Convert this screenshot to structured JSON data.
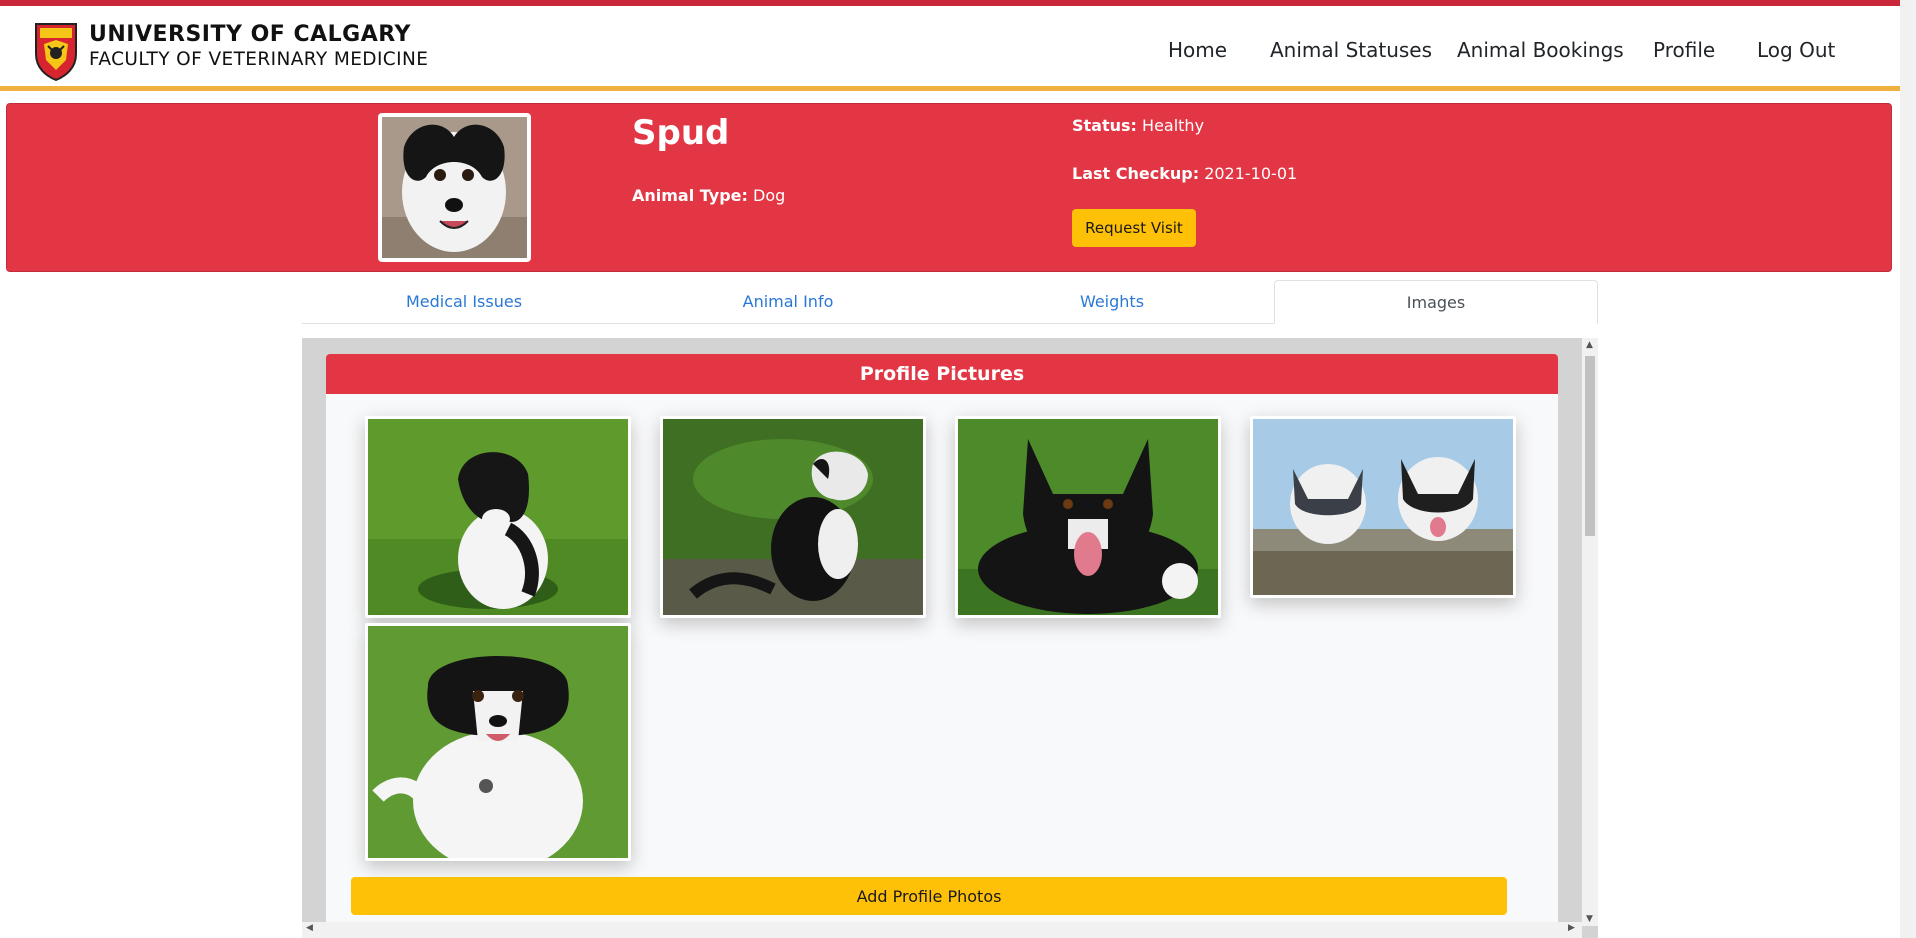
{
  "brand": {
    "line1": "UNIVERSITY OF CALGARY",
    "line2": "FACULTY OF VETERINARY MEDICINE"
  },
  "nav": {
    "items": [
      {
        "label": "Home"
      },
      {
        "label": "Animal Statuses"
      },
      {
        "label": "Animal Bookings"
      },
      {
        "label": "Profile"
      },
      {
        "label": "Log Out"
      }
    ]
  },
  "animal": {
    "name": "Spud",
    "type_label": "Animal Type:",
    "type_value": "Dog",
    "status_label": "Status:",
    "status_value": "Healthy",
    "checkup_label": "Last Checkup:",
    "checkup_value": "2021-10-01",
    "request_button": "Request Visit"
  },
  "tabs": [
    {
      "label": "Medical Issues"
    },
    {
      "label": "Animal Info"
    },
    {
      "label": "Weights"
    },
    {
      "label": "Images"
    }
  ],
  "profile_pictures": {
    "header": "Profile Pictures",
    "add_button": "Add Profile Photos",
    "photos": [
      "dog-photo",
      "dog-photo",
      "dog-photo",
      "dog-photo",
      "dog-photo"
    ]
  },
  "colors": {
    "brand_red": "#e23645",
    "accent_yellow": "#ffc107",
    "link_blue": "#2a78d6"
  }
}
